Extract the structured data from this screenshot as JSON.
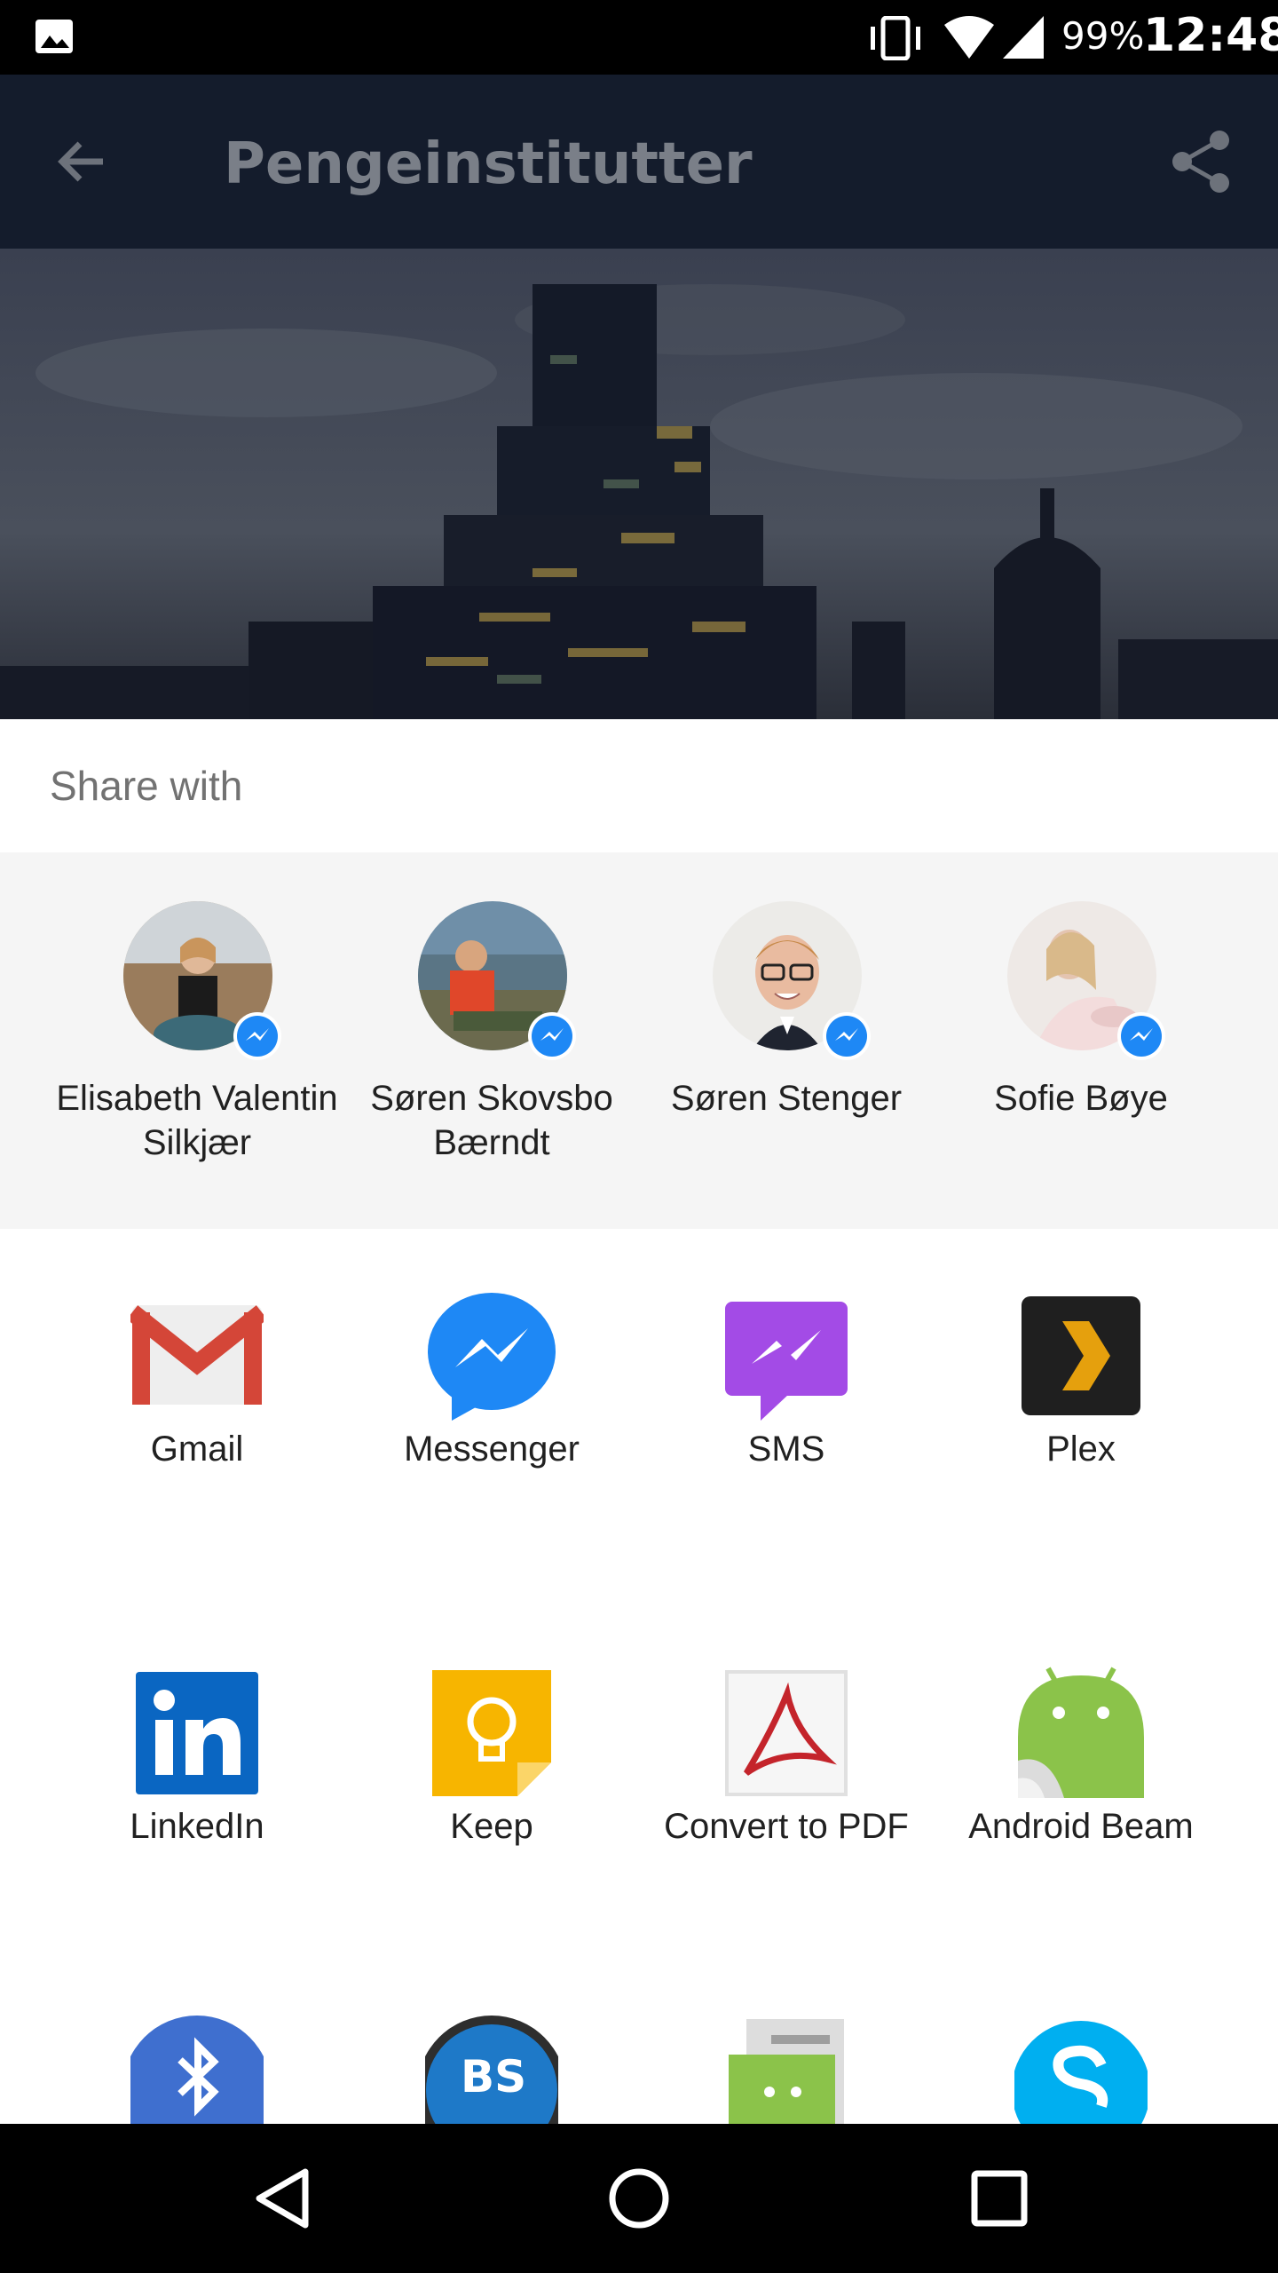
{
  "status_bar": {
    "battery": "99%",
    "time": "12:48",
    "icons": [
      "gallery-icon",
      "vibrate-icon",
      "wifi-icon",
      "cell-signal-icon"
    ]
  },
  "app_bar": {
    "title": "Pengeinstitutter",
    "icons": [
      "back-arrow-icon",
      "share-icon"
    ]
  },
  "share_sheet": {
    "title": "Share with",
    "contacts": [
      {
        "name": "Elisabeth Valentin Silkjær"
      },
      {
        "name": "Søren Skovsbo Bærndt"
      },
      {
        "name": "Søren Stenger"
      },
      {
        "name": "Sofie Bøye"
      }
    ],
    "apps": [
      {
        "label": "Gmail",
        "icon": "gmail-icon"
      },
      {
        "label": "Messenger",
        "icon": "messenger-icon"
      },
      {
        "label": "SMS",
        "icon": "sms-icon"
      },
      {
        "label": "Plex",
        "icon": "plex-icon"
      },
      {
        "label": "LinkedIn",
        "icon": "linkedin-icon"
      },
      {
        "label": "Keep",
        "icon": "keep-icon"
      },
      {
        "label": "Convert to PDF",
        "icon": "pdf-icon"
      },
      {
        "label": "Android Beam",
        "icon": "android-beam-icon"
      }
    ],
    "partial_apps": [
      "bluetooth-icon",
      "bs-player-icon",
      "messaging-icon",
      "skype-icon"
    ]
  },
  "colors": {
    "app_bar": "#141c2c",
    "contacts_bg": "#f5f5f5",
    "messenger_blue": "#1e88f5"
  }
}
